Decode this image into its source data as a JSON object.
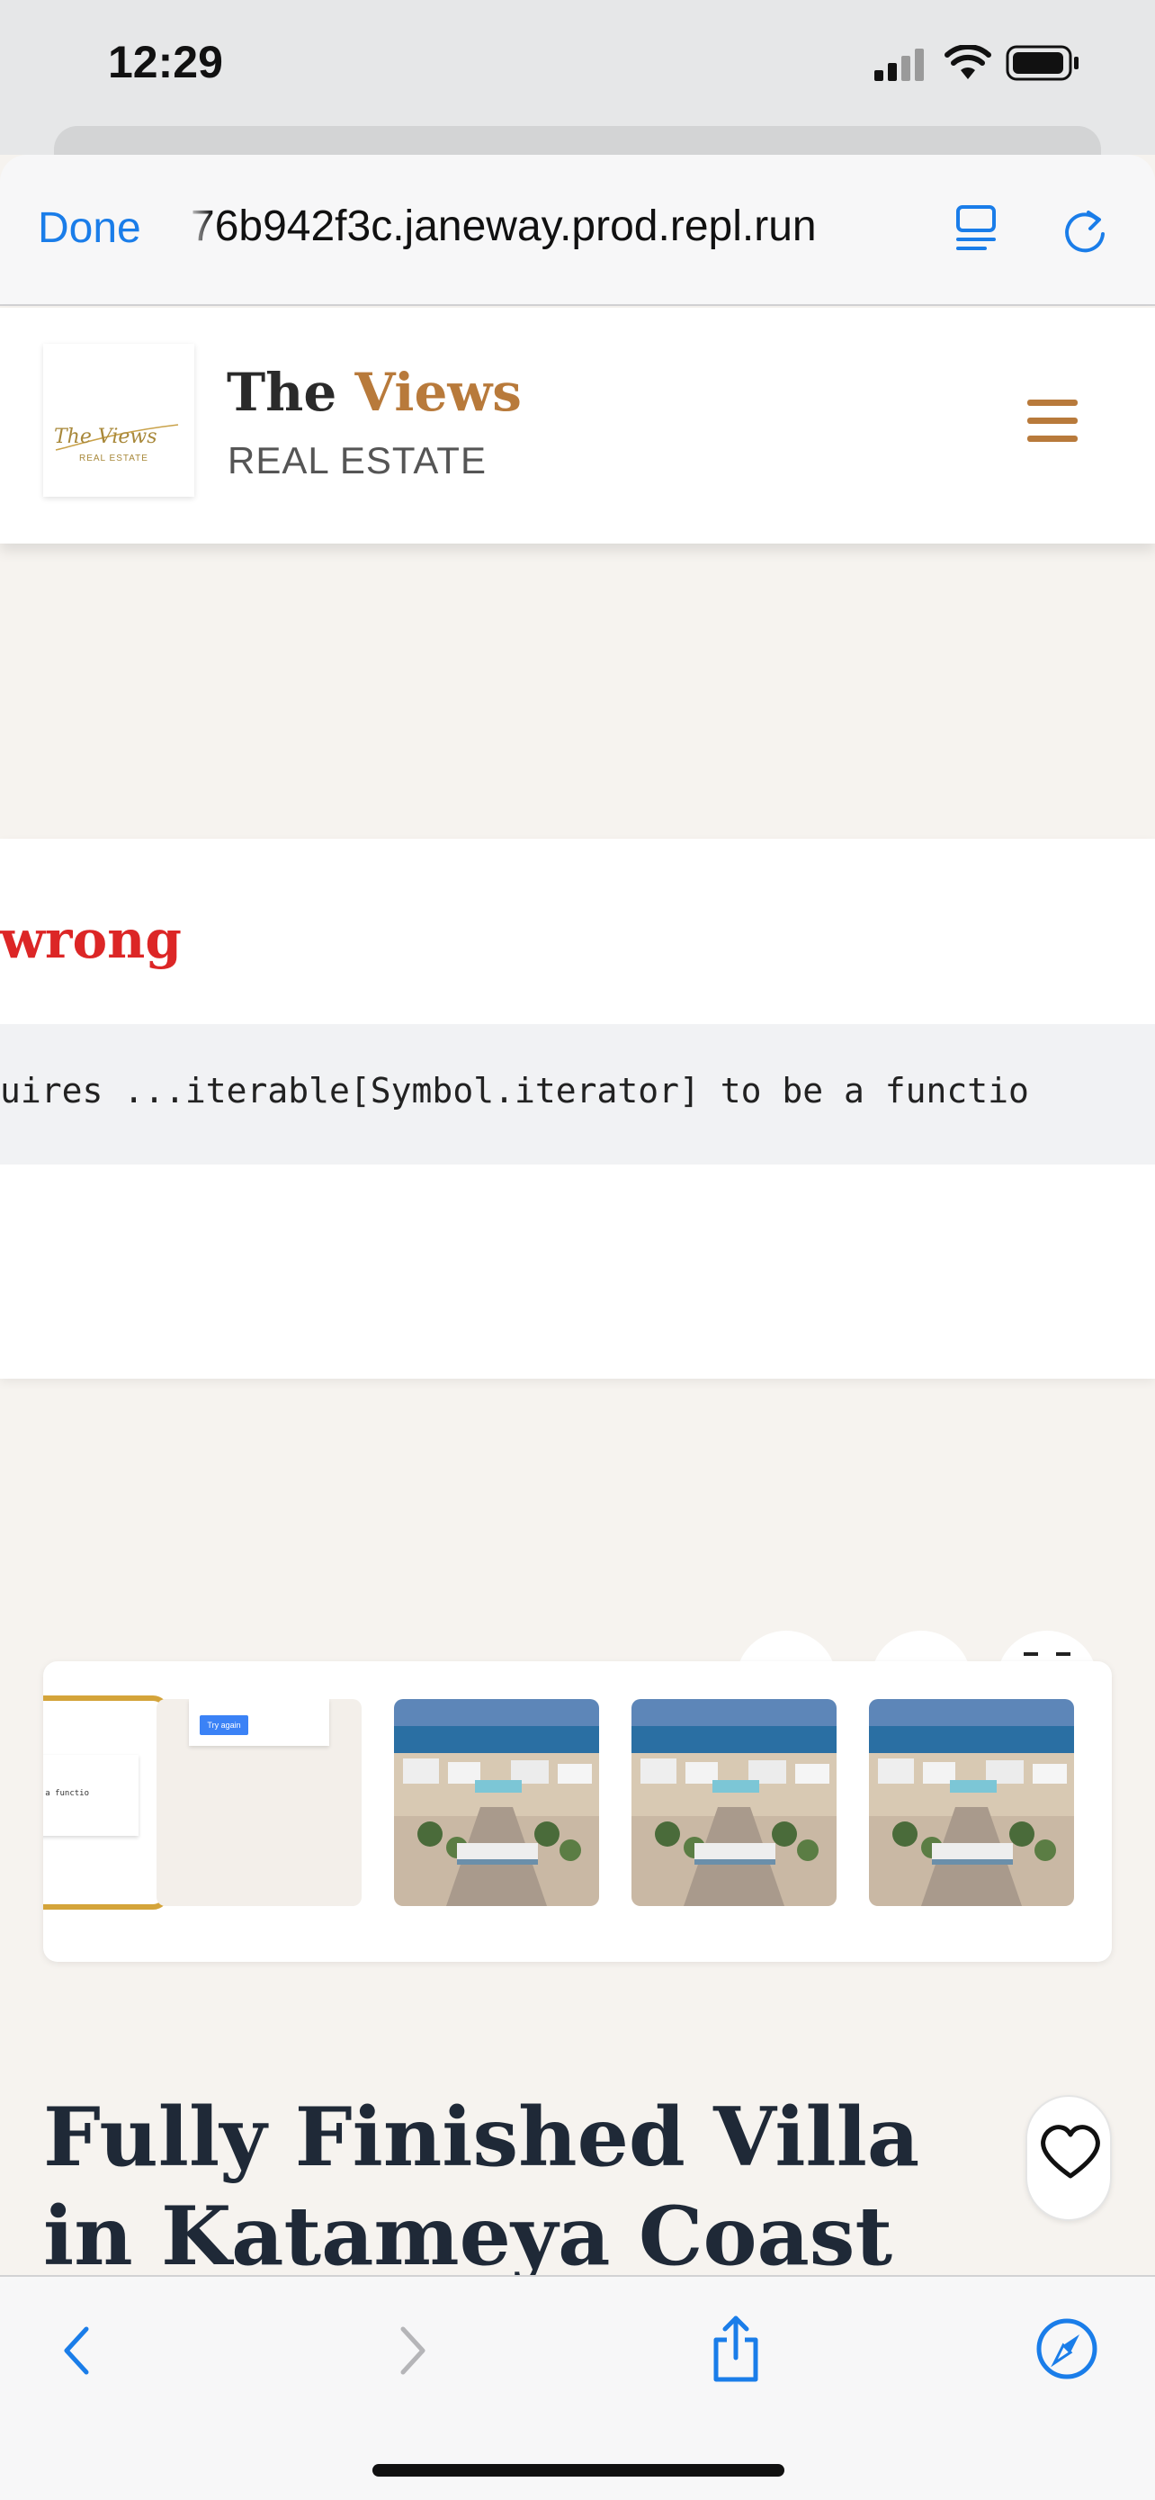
{
  "status_bar": {
    "time": "12:29",
    "icons": [
      "cellular-signal-icon",
      "wifi-icon",
      "battery-icon"
    ]
  },
  "browser": {
    "done_label": "Done",
    "url": "76b942f3c.janeway.prod.repl.run",
    "icons": [
      "display-mode-icon",
      "reload-icon"
    ],
    "accent_color": "#1a7de9"
  },
  "site_header": {
    "brand_the": "The",
    "brand_views": "Views",
    "brand_sub": "REAL ESTATE",
    "logo_text": "The Views",
    "logo_sub": "REAL ESTATE",
    "accent_color": "#b87a3b"
  },
  "error": {
    "title_fragment": "wrong",
    "message_fragment": "uires ...iterable[Symbol.iterator] to be a functio",
    "title_color": "#dc2626"
  },
  "thumbnails": {
    "active_fragment": "be a functio",
    "try_again_label": "Try again",
    "count": 5,
    "active_color": "#d4a43a"
  },
  "listing": {
    "title": "Fully Finished Villa in Katameya Coast",
    "favorite_icon": "heart-icon"
  },
  "toolbar": {
    "icons": [
      "back-icon",
      "forward-icon",
      "share-icon",
      "compass-icon"
    ]
  }
}
